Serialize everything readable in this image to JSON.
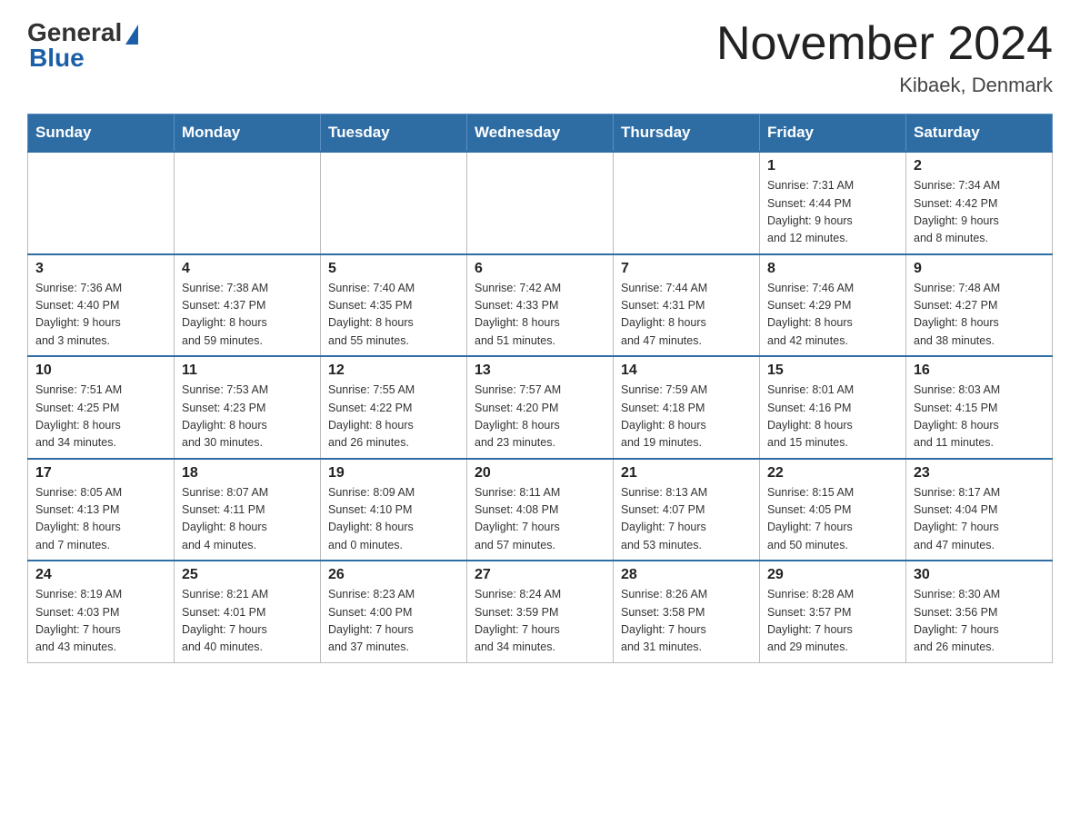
{
  "header": {
    "logo_general": "General",
    "logo_blue": "Blue",
    "month_title": "November 2024",
    "location": "Kibaek, Denmark"
  },
  "weekdays": [
    "Sunday",
    "Monday",
    "Tuesday",
    "Wednesday",
    "Thursday",
    "Friday",
    "Saturday"
  ],
  "weeks": [
    {
      "days": [
        {
          "number": "",
          "info": ""
        },
        {
          "number": "",
          "info": ""
        },
        {
          "number": "",
          "info": ""
        },
        {
          "number": "",
          "info": ""
        },
        {
          "number": "",
          "info": ""
        },
        {
          "number": "1",
          "info": "Sunrise: 7:31 AM\nSunset: 4:44 PM\nDaylight: 9 hours\nand 12 minutes."
        },
        {
          "number": "2",
          "info": "Sunrise: 7:34 AM\nSunset: 4:42 PM\nDaylight: 9 hours\nand 8 minutes."
        }
      ]
    },
    {
      "days": [
        {
          "number": "3",
          "info": "Sunrise: 7:36 AM\nSunset: 4:40 PM\nDaylight: 9 hours\nand 3 minutes."
        },
        {
          "number": "4",
          "info": "Sunrise: 7:38 AM\nSunset: 4:37 PM\nDaylight: 8 hours\nand 59 minutes."
        },
        {
          "number": "5",
          "info": "Sunrise: 7:40 AM\nSunset: 4:35 PM\nDaylight: 8 hours\nand 55 minutes."
        },
        {
          "number": "6",
          "info": "Sunrise: 7:42 AM\nSunset: 4:33 PM\nDaylight: 8 hours\nand 51 minutes."
        },
        {
          "number": "7",
          "info": "Sunrise: 7:44 AM\nSunset: 4:31 PM\nDaylight: 8 hours\nand 47 minutes."
        },
        {
          "number": "8",
          "info": "Sunrise: 7:46 AM\nSunset: 4:29 PM\nDaylight: 8 hours\nand 42 minutes."
        },
        {
          "number": "9",
          "info": "Sunrise: 7:48 AM\nSunset: 4:27 PM\nDaylight: 8 hours\nand 38 minutes."
        }
      ]
    },
    {
      "days": [
        {
          "number": "10",
          "info": "Sunrise: 7:51 AM\nSunset: 4:25 PM\nDaylight: 8 hours\nand 34 minutes."
        },
        {
          "number": "11",
          "info": "Sunrise: 7:53 AM\nSunset: 4:23 PM\nDaylight: 8 hours\nand 30 minutes."
        },
        {
          "number": "12",
          "info": "Sunrise: 7:55 AM\nSunset: 4:22 PM\nDaylight: 8 hours\nand 26 minutes."
        },
        {
          "number": "13",
          "info": "Sunrise: 7:57 AM\nSunset: 4:20 PM\nDaylight: 8 hours\nand 23 minutes."
        },
        {
          "number": "14",
          "info": "Sunrise: 7:59 AM\nSunset: 4:18 PM\nDaylight: 8 hours\nand 19 minutes."
        },
        {
          "number": "15",
          "info": "Sunrise: 8:01 AM\nSunset: 4:16 PM\nDaylight: 8 hours\nand 15 minutes."
        },
        {
          "number": "16",
          "info": "Sunrise: 8:03 AM\nSunset: 4:15 PM\nDaylight: 8 hours\nand 11 minutes."
        }
      ]
    },
    {
      "days": [
        {
          "number": "17",
          "info": "Sunrise: 8:05 AM\nSunset: 4:13 PM\nDaylight: 8 hours\nand 7 minutes."
        },
        {
          "number": "18",
          "info": "Sunrise: 8:07 AM\nSunset: 4:11 PM\nDaylight: 8 hours\nand 4 minutes."
        },
        {
          "number": "19",
          "info": "Sunrise: 8:09 AM\nSunset: 4:10 PM\nDaylight: 8 hours\nand 0 minutes."
        },
        {
          "number": "20",
          "info": "Sunrise: 8:11 AM\nSunset: 4:08 PM\nDaylight: 7 hours\nand 57 minutes."
        },
        {
          "number": "21",
          "info": "Sunrise: 8:13 AM\nSunset: 4:07 PM\nDaylight: 7 hours\nand 53 minutes."
        },
        {
          "number": "22",
          "info": "Sunrise: 8:15 AM\nSunset: 4:05 PM\nDaylight: 7 hours\nand 50 minutes."
        },
        {
          "number": "23",
          "info": "Sunrise: 8:17 AM\nSunset: 4:04 PM\nDaylight: 7 hours\nand 47 minutes."
        }
      ]
    },
    {
      "days": [
        {
          "number": "24",
          "info": "Sunrise: 8:19 AM\nSunset: 4:03 PM\nDaylight: 7 hours\nand 43 minutes."
        },
        {
          "number": "25",
          "info": "Sunrise: 8:21 AM\nSunset: 4:01 PM\nDaylight: 7 hours\nand 40 minutes."
        },
        {
          "number": "26",
          "info": "Sunrise: 8:23 AM\nSunset: 4:00 PM\nDaylight: 7 hours\nand 37 minutes."
        },
        {
          "number": "27",
          "info": "Sunrise: 8:24 AM\nSunset: 3:59 PM\nDaylight: 7 hours\nand 34 minutes."
        },
        {
          "number": "28",
          "info": "Sunrise: 8:26 AM\nSunset: 3:58 PM\nDaylight: 7 hours\nand 31 minutes."
        },
        {
          "number": "29",
          "info": "Sunrise: 8:28 AM\nSunset: 3:57 PM\nDaylight: 7 hours\nand 29 minutes."
        },
        {
          "number": "30",
          "info": "Sunrise: 8:30 AM\nSunset: 3:56 PM\nDaylight: 7 hours\nand 26 minutes."
        }
      ]
    }
  ]
}
